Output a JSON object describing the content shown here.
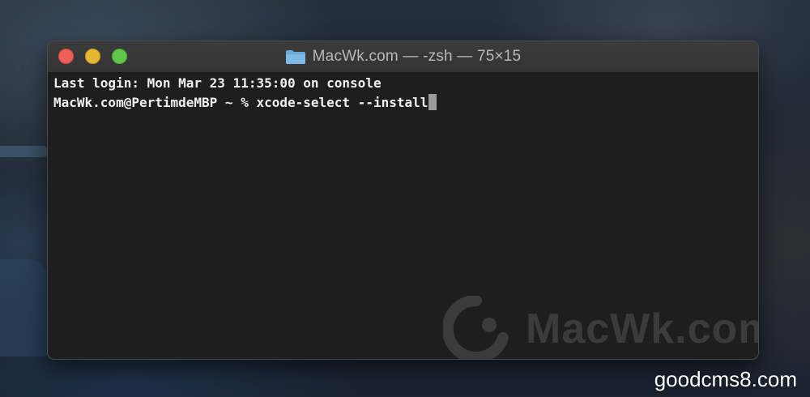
{
  "window": {
    "title": "MacWk.com — -zsh — 75×15",
    "title_icon": "folder-icon",
    "traffic_lights": {
      "close_color": "#ed5f57",
      "minimize_color": "#e5b631",
      "zoom_color": "#60c54a"
    }
  },
  "terminal": {
    "last_login": "Last login: Mon Mar 23 11:35:00 on console",
    "prompt": "MacWk.com@PertimdeMBP ~ % ",
    "command": "xcode-select --install",
    "background_color": "#1e1e1e",
    "text_color": "#f0f0f0"
  },
  "watermark": {
    "text": "MacWk.com",
    "icon": "macwk-logo-icon"
  },
  "caption": {
    "text": "goodcms8.com"
  }
}
